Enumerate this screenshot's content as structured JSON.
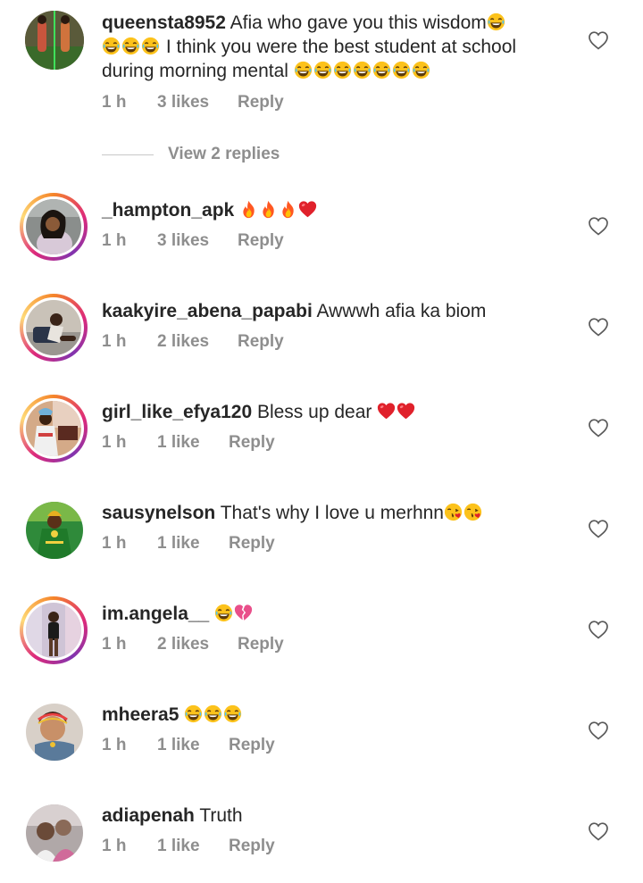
{
  "comments": [
    {
      "username": "queensta8952",
      "text_line1": " Afia who gave you this wisdom",
      "text_line2": " I think you were the best student at school",
      "text_line3": "during morning mental ",
      "time": "1 h",
      "likes": "3 likes",
      "reply": "Reply"
    },
    {
      "username": "_hampton_apk",
      "text": " ",
      "time": "1 h",
      "likes": "3 likes",
      "reply": "Reply"
    },
    {
      "username": "kaakyire_abena_papabi",
      "text": " Awwwh afia ka biom",
      "time": "1 h",
      "likes": "2 likes",
      "reply": "Reply"
    },
    {
      "username": "girl_like_efya120",
      "text": " Bless up dear ",
      "time": "1 h",
      "likes": "1 like",
      "reply": "Reply"
    },
    {
      "username": "sausynelson",
      "text": " That's why I love u merhnn",
      "time": "1 h",
      "likes": "1 like",
      "reply": "Reply"
    },
    {
      "username": "im.angela__",
      "text": " ",
      "time": "1 h",
      "likes": "2 likes",
      "reply": "Reply"
    },
    {
      "username": "mheera5",
      "text": " ",
      "time": "1 h",
      "likes": "1 like",
      "reply": "Reply"
    },
    {
      "username": "adiapenah",
      "text": " Truth",
      "time": "1 h",
      "likes": "1 like",
      "reply": "Reply"
    }
  ],
  "view_replies": "View 2 replies",
  "icons": {
    "like": "heart-outline-icon",
    "laugh": "face-with-tears-of-joy-emoji",
    "fire": "fire-emoji",
    "red_heart": "red-heart-emoji",
    "kiss": "face-blowing-kiss-emoji",
    "broken_heart": "broken-heart-emoji"
  },
  "colors": {
    "text": "#262626",
    "muted": "#8e8e8e",
    "story_ring": "#dd2a7b"
  }
}
